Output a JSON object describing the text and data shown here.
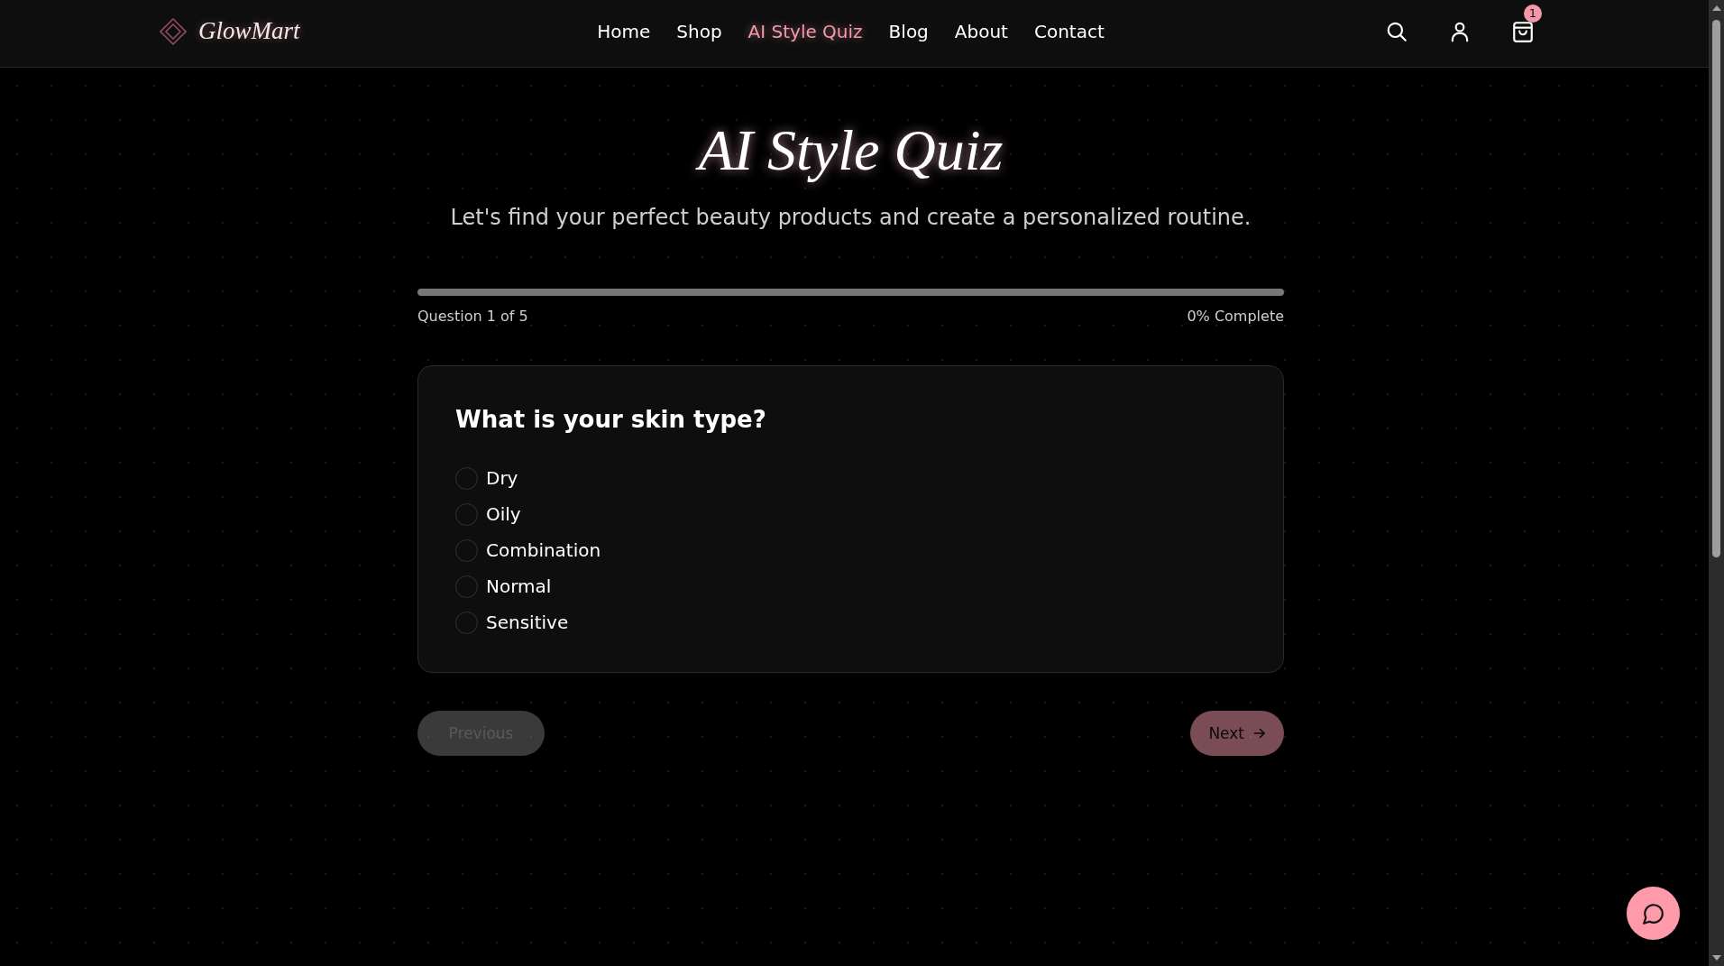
{
  "header": {
    "logo": "GlowMart",
    "nav": [
      {
        "label": "Home",
        "selected": false
      },
      {
        "label": "Shop",
        "selected": false
      },
      {
        "label": "AI Style Quiz",
        "selected": true
      },
      {
        "label": "Blog",
        "selected": false
      },
      {
        "label": "About",
        "selected": false
      },
      {
        "label": "Contact",
        "selected": false
      }
    ],
    "cart_count": "1"
  },
  "hero": {
    "title": "AI Style Quiz",
    "subtitle": "Let's find your perfect beauty products and create a personalized routine."
  },
  "progress": {
    "question_label": "Question 1 of 5",
    "percent_label": "0% Complete",
    "level": 0
  },
  "question": {
    "title": "What is your skin type?",
    "options": [
      {
        "label": "Dry",
        "selected": false
      },
      {
        "label": "Oily",
        "selected": false
      },
      {
        "label": "Combination",
        "selected": false
      },
      {
        "label": "Normal",
        "selected": false
      },
      {
        "label": "Sensitive",
        "selected": false
      }
    ]
  },
  "buttons": [
    {
      "kind": "secondary",
      "label": "Previous",
      "disabled": true
    },
    {
      "kind": "primary",
      "label": "Next",
      "disabled": true
    }
  ]
}
